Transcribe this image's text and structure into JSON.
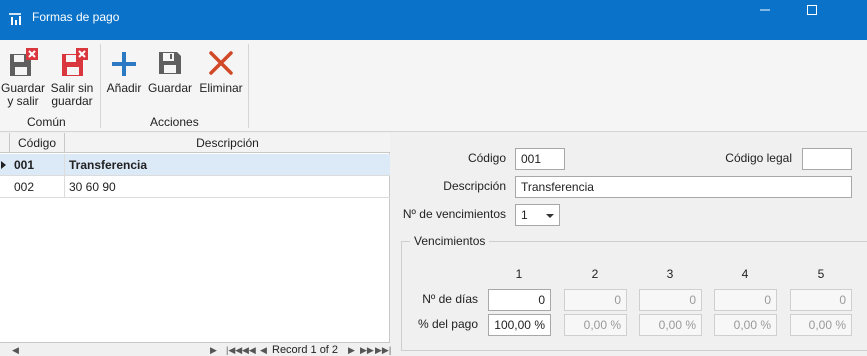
{
  "window": {
    "title": "Formas de pago",
    "minimize": "—",
    "maximize": "☐"
  },
  "ribbon": {
    "buttons": {
      "save_exit": [
        "Guardar",
        "y salir"
      ],
      "exit_nosave": [
        "Salir sin",
        "guardar"
      ],
      "add": "Añadir",
      "save": "Guardar",
      "delete": "Eliminar"
    },
    "groups": {
      "common": "Común",
      "actions": "Acciones"
    },
    "colors": {
      "gray": "#5f5f5f",
      "red": "#d9363e",
      "blue": "#2b79c2",
      "delete_red": "#d24726"
    }
  },
  "grid": {
    "columns": [
      "Código",
      "Descripción"
    ],
    "rows": [
      {
        "code": "001",
        "description": "Transferencia",
        "selected": true
      },
      {
        "code": "002",
        "description": "30 60 90",
        "selected": false
      }
    ],
    "footer": {
      "record_label": "Record 1 of 2"
    }
  },
  "form": {
    "codigo_label": "Código",
    "codigo_value": "001",
    "codigo_legal_label": "Código legal",
    "codigo_legal_value": "",
    "descripcion_label": "Descripción",
    "descripcion_value": "Transferencia",
    "vencimientos_label": "Nº de vencimientos",
    "vencimientos_value": "1",
    "group_title": "Vencimientos",
    "columns": [
      "1",
      "2",
      "3",
      "4",
      "5"
    ],
    "dias_label": "Nº de días",
    "dias_values": [
      "0",
      "0",
      "0",
      "0",
      "0"
    ],
    "pago_label": "% del pago",
    "pago_values": [
      "100,00 %",
      "0,00 %",
      "0,00 %",
      "0,00 %",
      "0,00 %"
    ]
  }
}
